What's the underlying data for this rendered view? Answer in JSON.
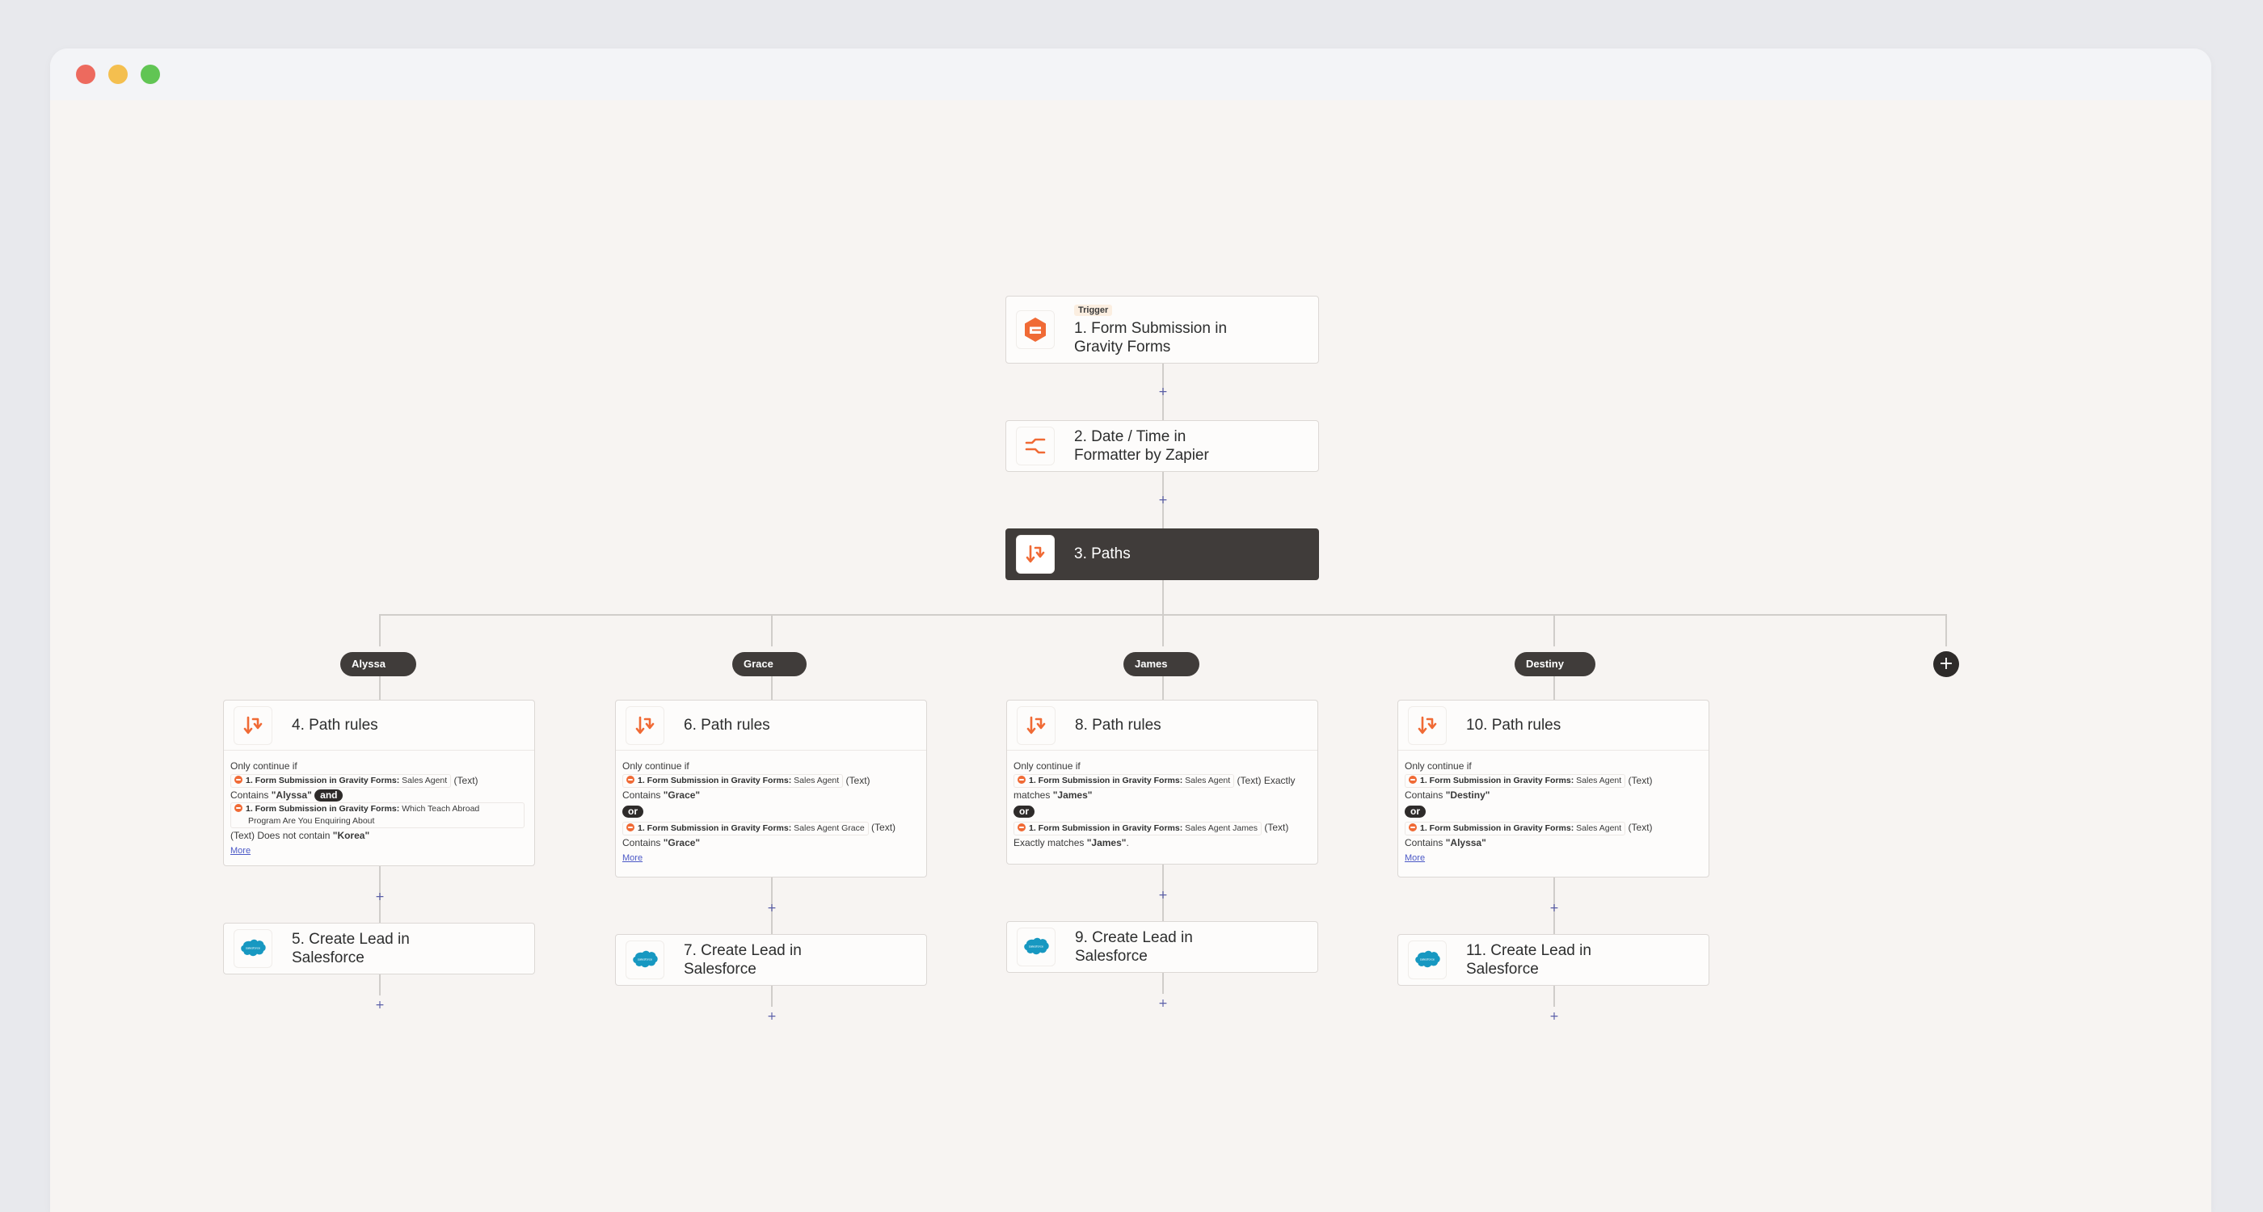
{
  "window": {
    "controls": [
      "close",
      "minimize",
      "maximize"
    ]
  },
  "colors": {
    "accent_orange": "#f06a35",
    "dark_node": "#403c3a",
    "canvas": "#f7f4f2",
    "salesforce_blue": "#1798c1",
    "link": "#4b58c6"
  },
  "steps": {
    "trigger": {
      "tag": "Trigger",
      "title_line1": "1. Form Submission in",
      "title_line2": "Gravity Forms",
      "icon": "gravity-forms-icon"
    },
    "formatter": {
      "title_line1": "2. Date / Time in",
      "title_line2": "Formatter by Zapier",
      "icon": "formatter-icon"
    },
    "paths": {
      "title": "3. Paths",
      "icon": "paths-icon"
    }
  },
  "branches": [
    {
      "name": "Alyssa",
      "rules": {
        "title": "4. Path rules",
        "intro": "Only continue if",
        "field_source": "1. Form Submission in Gravity Forms:",
        "c1_field": "Sales Agent",
        "c1_type": "(Text)",
        "c1_op": "Contains",
        "c1_value": "\"Alyssa\"",
        "joiner": "and",
        "c2_field_line1": "Which Teach Abroad",
        "c2_field_line2": "Program Are You Enquiring About",
        "c2_type": "(Text)",
        "c2_op": "Does not contain",
        "c2_value": "\"Korea\"",
        "more": "More"
      },
      "action": {
        "title_line1": "5. Create Lead in",
        "title_line2": "Salesforce"
      }
    },
    {
      "name": "Grace",
      "rules": {
        "title": "6. Path rules",
        "intro": "Only continue if",
        "field_source": "1. Form Submission in Gravity Forms:",
        "c1_field": "Sales Agent",
        "c1_type": "(Text)",
        "c1_op": "Contains",
        "c1_value": "\"Grace\"",
        "joiner": "or",
        "c2_field": "Sales Agent Grace",
        "c2_type": "(Text)",
        "c2_op": "Contains",
        "c2_value": "\"Grace\"",
        "more": "More"
      },
      "action": {
        "title_line1": "7. Create Lead in",
        "title_line2": "Salesforce"
      }
    },
    {
      "name": "James",
      "rules": {
        "title": "8. Path rules",
        "intro": "Only continue if",
        "field_source": "1. Form Submission in Gravity Forms:",
        "c1_field": "Sales Agent",
        "c1_type": "(Text) Exactly",
        "c1_op": "matches",
        "c1_value": "\"James\"",
        "joiner": "or",
        "c2_field": "Sales Agent James",
        "c2_type": "(Text)",
        "c2_op": "Exactly matches",
        "c2_value": "\"James\"",
        "c2_suffix": "."
      },
      "action": {
        "title_line1": "9. Create Lead in",
        "title_line2": "Salesforce"
      }
    },
    {
      "name": "Destiny",
      "rules": {
        "title": "10. Path rules",
        "intro": "Only continue if",
        "field_source": "1. Form Submission in Gravity Forms:",
        "c1_field": "Sales Agent",
        "c1_type": "(Text)",
        "c1_op": "Contains",
        "c1_value": "\"Destiny\"",
        "joiner": "or",
        "c2_field": "Sales Agent",
        "c2_type": "(Text)",
        "c2_op": "Contains",
        "c2_value": "\"Alyssa\"",
        "more": "More"
      },
      "action": {
        "title_line1": "11. Create Lead in",
        "title_line2": "Salesforce"
      }
    }
  ],
  "add_step_symbol": "+",
  "add_branch_symbol": "+"
}
